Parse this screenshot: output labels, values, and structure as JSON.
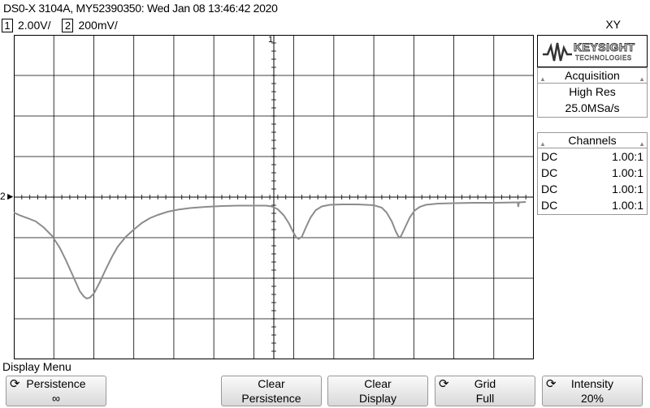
{
  "header": {
    "title": "DS0-X 3104A, MY52390350: Wed Jan 08 13:46:42 2020",
    "mode": "XY"
  },
  "channels_bar": [
    {
      "num": "1",
      "scale": "2.00V/"
    },
    {
      "num": "2",
      "scale": "200mV/"
    }
  ],
  "markers": {
    "ch1": "1",
    "ch2": "2"
  },
  "logo": {
    "brand": "KEYSIGHT",
    "sub": "TECHNOLOGIES"
  },
  "acquisition": {
    "heading": "Acquisition",
    "mode": "High Res",
    "rate": "25.0MSa/s"
  },
  "channels_panel": {
    "heading": "Channels",
    "rows": [
      {
        "coupling": "DC",
        "probe": "1.00:1"
      },
      {
        "coupling": "DC",
        "probe": "1.00:1"
      },
      {
        "coupling": "DC",
        "probe": "1.00:1"
      },
      {
        "coupling": "DC",
        "probe": "1.00:1"
      }
    ]
  },
  "menu": {
    "title": "Display Menu",
    "keys": [
      {
        "line1": "Persistence",
        "line2": "∞",
        "icon": "rotate-knob-icon"
      },
      {
        "line1": "Clear",
        "line2": "Persistence",
        "icon": ""
      },
      {
        "line1": "Clear",
        "line2": "Display",
        "icon": ""
      },
      {
        "line1": "Grid",
        "line2": "Full",
        "icon": "rotate-knob-icon"
      },
      {
        "line1": "Intensity",
        "line2": "20%",
        "icon": "rotate-knob-icon"
      }
    ]
  },
  "colors": {
    "trace": "#8c8c8c",
    "grid": "#000000",
    "panel_border": "#999999"
  },
  "trace": {
    "note_units": "divisions",
    "points": [
      [
        0.0,
        -0.38
      ],
      [
        0.15,
        -0.45
      ],
      [
        0.35,
        -0.52
      ],
      [
        0.55,
        -0.6
      ],
      [
        0.75,
        -0.75
      ],
      [
        0.95,
        -0.95
      ],
      [
        1.15,
        -1.25
      ],
      [
        1.3,
        -1.55
      ],
      [
        1.45,
        -1.88
      ],
      [
        1.55,
        -2.1
      ],
      [
        1.65,
        -2.32
      ],
      [
        1.75,
        -2.45
      ],
      [
        1.82,
        -2.5
      ],
      [
        1.9,
        -2.48
      ],
      [
        2.0,
        -2.38
      ],
      [
        2.15,
        -2.1
      ],
      [
        2.3,
        -1.78
      ],
      [
        2.45,
        -1.48
      ],
      [
        2.6,
        -1.22
      ],
      [
        2.8,
        -0.98
      ],
      [
        3.0,
        -0.8
      ],
      [
        3.2,
        -0.64
      ],
      [
        3.4,
        -0.52
      ],
      [
        3.6,
        -0.44
      ],
      [
        3.85,
        -0.36
      ],
      [
        4.1,
        -0.31
      ],
      [
        4.4,
        -0.27
      ],
      [
        4.8,
        -0.24
      ],
      [
        5.2,
        -0.22
      ],
      [
        5.6,
        -0.21
      ],
      [
        6.0,
        -0.21
      ],
      [
        6.3,
        -0.21
      ],
      [
        6.45,
        -0.23
      ],
      [
        6.6,
        -0.3
      ],
      [
        6.75,
        -0.45
      ],
      [
        6.88,
        -0.65
      ],
      [
        6.98,
        -0.85
      ],
      [
        7.05,
        -0.98
      ],
      [
        7.12,
        -1.03
      ],
      [
        7.2,
        -0.98
      ],
      [
        7.3,
        -0.75
      ],
      [
        7.42,
        -0.5
      ],
      [
        7.55,
        -0.32
      ],
      [
        7.7,
        -0.23
      ],
      [
        7.9,
        -0.19
      ],
      [
        8.2,
        -0.18
      ],
      [
        8.6,
        -0.18
      ],
      [
        9.0,
        -0.2
      ],
      [
        9.2,
        -0.26
      ],
      [
        9.32,
        -0.38
      ],
      [
        9.45,
        -0.6
      ],
      [
        9.55,
        -0.85
      ],
      [
        9.63,
        -1.0
      ],
      [
        9.68,
        -0.96
      ],
      [
        9.78,
        -0.75
      ],
      [
        9.9,
        -0.5
      ],
      [
        10.02,
        -0.33
      ],
      [
        10.15,
        -0.24
      ],
      [
        10.3,
        -0.19
      ],
      [
        10.6,
        -0.16
      ],
      [
        11.0,
        -0.15
      ],
      [
        11.5,
        -0.14
      ],
      [
        12.0,
        -0.14
      ],
      [
        12.6,
        -0.13
      ],
      [
        12.61,
        -0.24
      ],
      [
        12.63,
        -0.13
      ],
      [
        12.8,
        -0.12
      ]
    ]
  }
}
